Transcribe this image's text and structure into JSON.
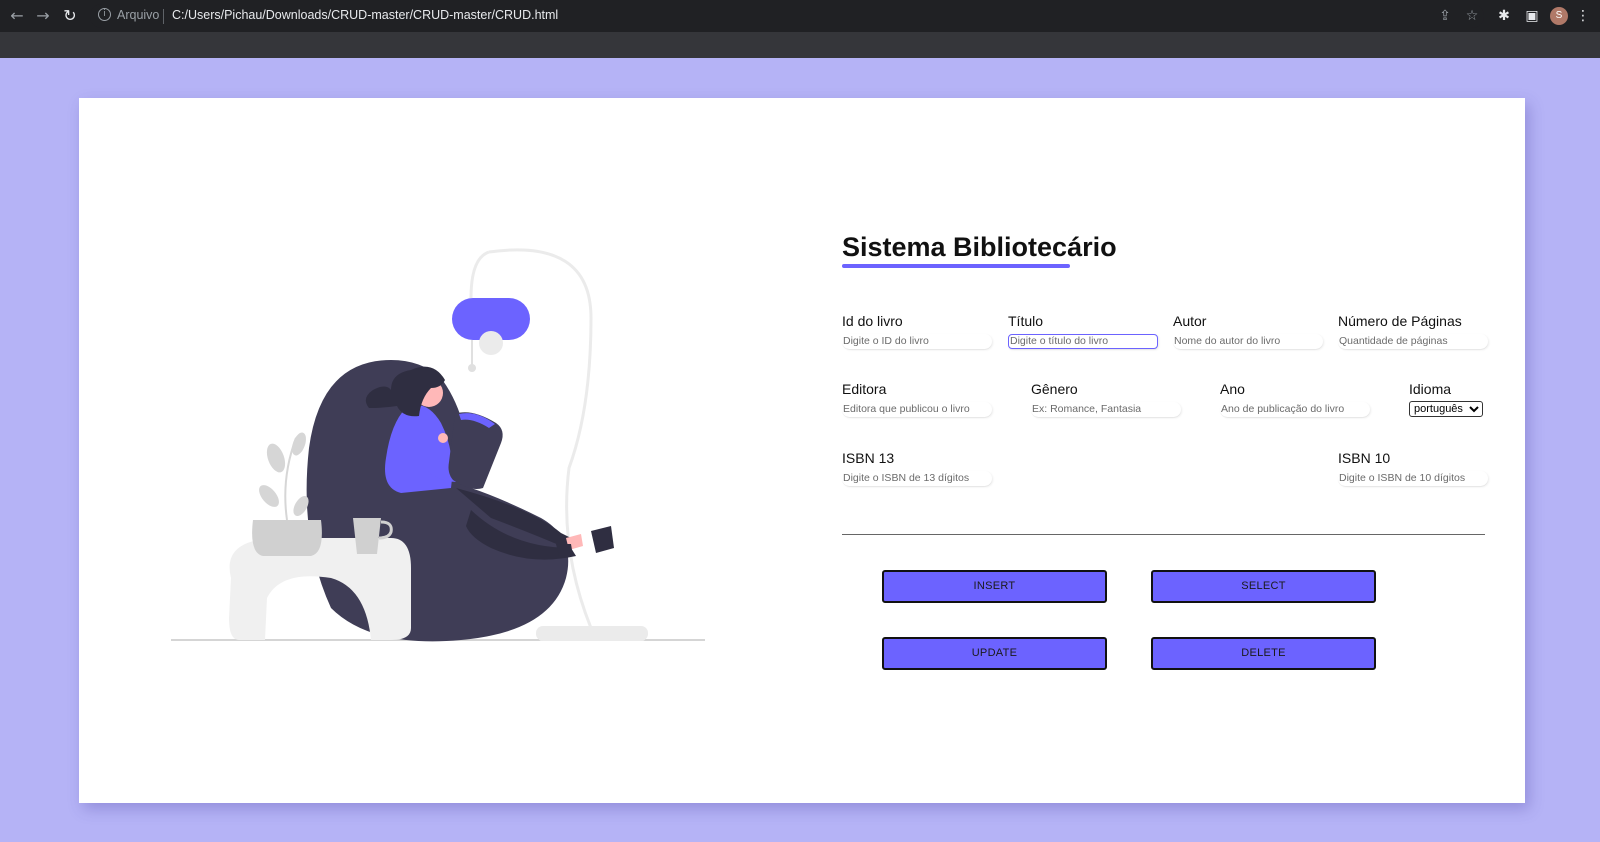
{
  "browser": {
    "scheme_label": "Arquivo",
    "url": "C:/Users/Pichau/Downloads/CRUD-master/CRUD-master/CRUD.html",
    "profile_initial": "S"
  },
  "page": {
    "title": "Sistema Bibliotecário",
    "accent_color": "#6c63ff",
    "background_color": "#b5b3f6"
  },
  "form": {
    "id": {
      "label": "Id do livro",
      "placeholder": "Digite o ID do livro"
    },
    "titulo": {
      "label": "Título",
      "placeholder": "Digite o título do livro"
    },
    "autor": {
      "label": "Autor",
      "placeholder": "Nome do autor do livro"
    },
    "paginas": {
      "label": "Número de Páginas",
      "placeholder": "Quantidade de páginas"
    },
    "editora": {
      "label": "Editora",
      "placeholder": "Editora que publicou o livro"
    },
    "genero": {
      "label": "Gênero",
      "placeholder": "Ex: Romance, Fantasia"
    },
    "ano": {
      "label": "Ano",
      "placeholder": "Ano de publicação do livro"
    },
    "idioma": {
      "label": "Idioma",
      "selected": "português"
    },
    "isbn13": {
      "label": "ISBN 13",
      "placeholder": "Digite o ISBN de 13 dígitos"
    },
    "isbn10": {
      "label": "ISBN 10",
      "placeholder": "Digite o ISBN de 10 dígitos"
    }
  },
  "actions": {
    "insert": "INSERT",
    "select": "SELECT",
    "update": "UPDATE",
    "delete": "DELETE"
  }
}
